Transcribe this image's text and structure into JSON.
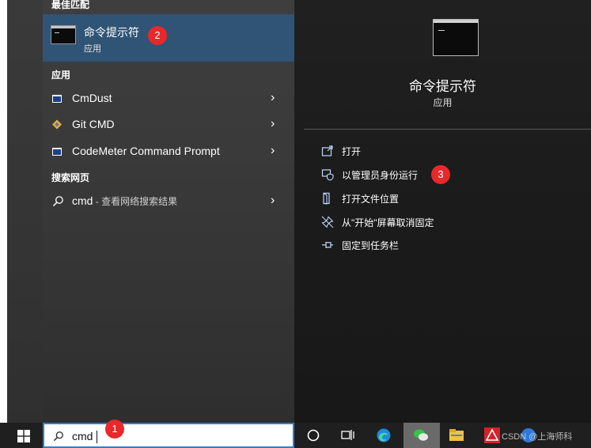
{
  "results": {
    "best_match_header": "最佳匹配",
    "best_match": {
      "title": "命令提示符",
      "subtitle": "应用"
    },
    "apps_header": "应用",
    "apps": [
      {
        "label": "CmDust",
        "sub": ""
      },
      {
        "label": "Git CMD",
        "sub": ""
      },
      {
        "label": "CodeMeter Command Prompt",
        "sub": ""
      }
    ],
    "web_header": "搜索网页",
    "web_result": {
      "query": "cmd",
      "sub": " - 查看网络搜索结果"
    }
  },
  "detail": {
    "title": "命令提示符",
    "subtitle": "应用",
    "actions": [
      {
        "label": "打开",
        "icon": "open-icon"
      },
      {
        "label": "以管理员身份运行",
        "icon": "shield-icon"
      },
      {
        "label": "打开文件位置",
        "icon": "file-location-icon"
      },
      {
        "label": "从\"开始\"屏幕取消固定",
        "icon": "unpin-icon"
      },
      {
        "label": "固定到任务栏",
        "icon": "pin-icon"
      }
    ]
  },
  "badges": {
    "b1": "1",
    "b2": "2",
    "b3": "3"
  },
  "taskbar": {
    "search_value": "cmd",
    "watermark": "CSDN @上海师科"
  },
  "colors": {
    "selected": "#2f5475",
    "badge": "#e8282a",
    "search_border": "#2b7fd6"
  }
}
